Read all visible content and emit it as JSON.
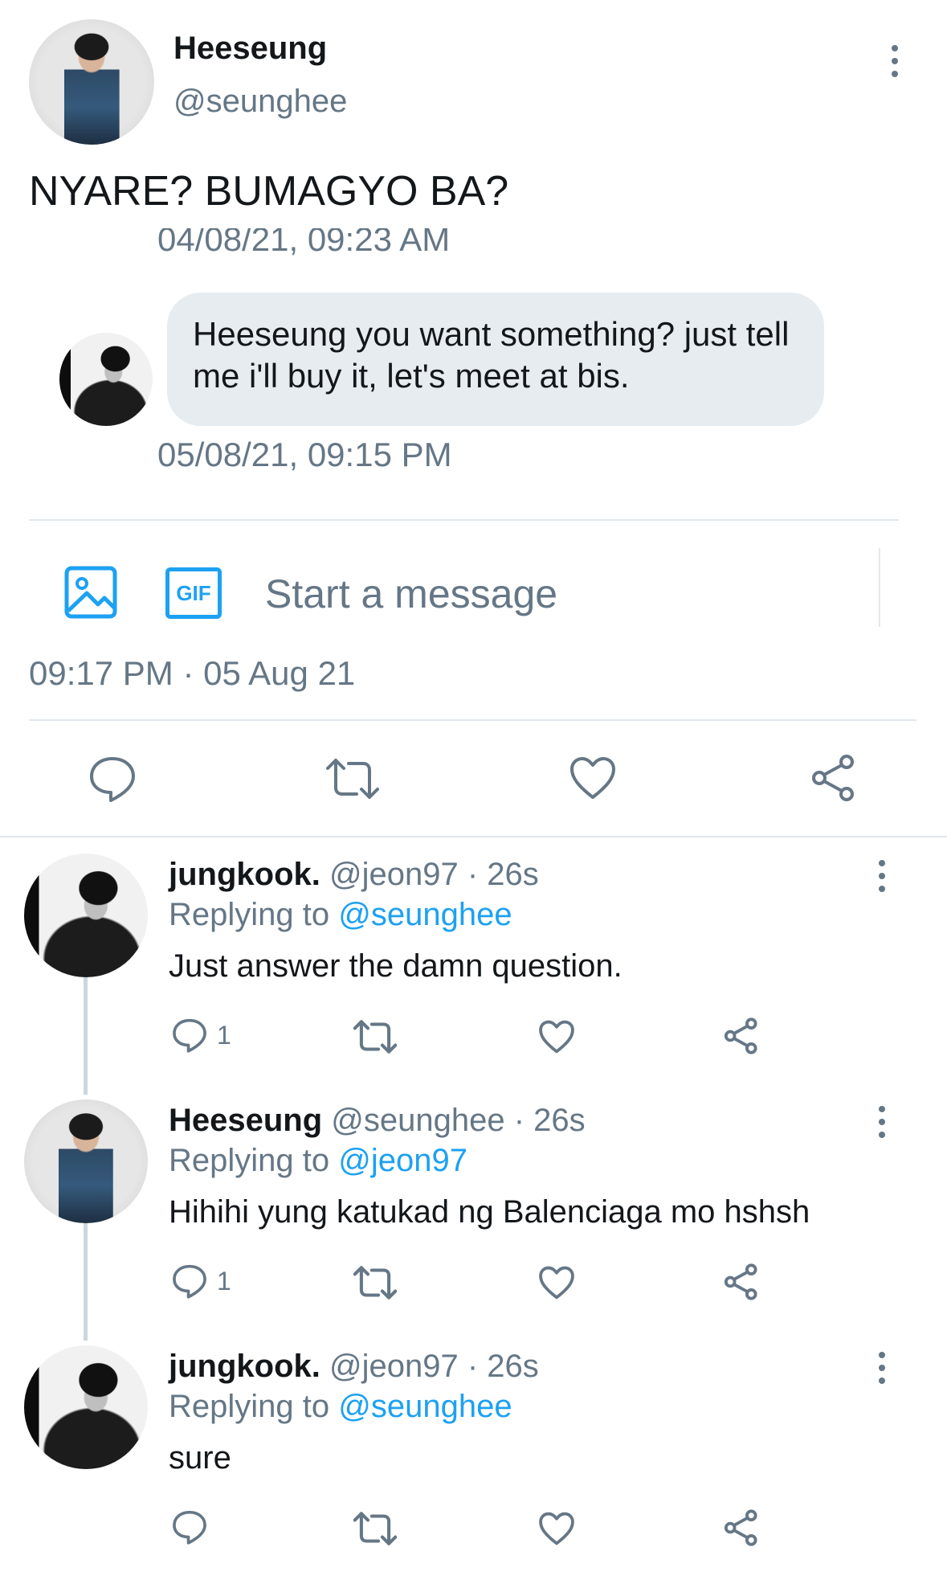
{
  "main_tweet": {
    "author_name": "Heeseung",
    "author_handle": "@seunghee",
    "text": "NYARE? BUMAGYO BA?",
    "timestamp": "09:17 PM · 05 Aug 21"
  },
  "dm": {
    "prev_timestamp": "04/08/21, 09:23 AM",
    "message": "Heeseung you want something? just tell me i'll buy it, let's meet at bis.",
    "timestamp": "05/08/21, 09:15 PM",
    "composer_placeholder": "Start a message",
    "gif_label": "GIF"
  },
  "replies": [
    {
      "name": "jungkook.",
      "handle": "@jeon97",
      "time": "26s",
      "replying_prefix": "Replying to",
      "replying_to": "@seunghee",
      "text": "Just answer the damn question.",
      "reply_count": "1"
    },
    {
      "name": "Heeseung",
      "handle": "@seunghee",
      "time": "26s",
      "replying_prefix": "Replying to",
      "replying_to": "@jeon97",
      "text": "Hihihi yung katukad ng Balenciaga mo hshsh",
      "reply_count": "1"
    },
    {
      "name": "jungkook.",
      "handle": "@jeon97",
      "time": "26s",
      "replying_prefix": "Replying to",
      "replying_to": "@seunghee",
      "text": "sure",
      "reply_count": ""
    }
  ],
  "colors": {
    "accent": "#1da1f2",
    "muted": "#657786",
    "bubble": "#e6ecf0"
  }
}
